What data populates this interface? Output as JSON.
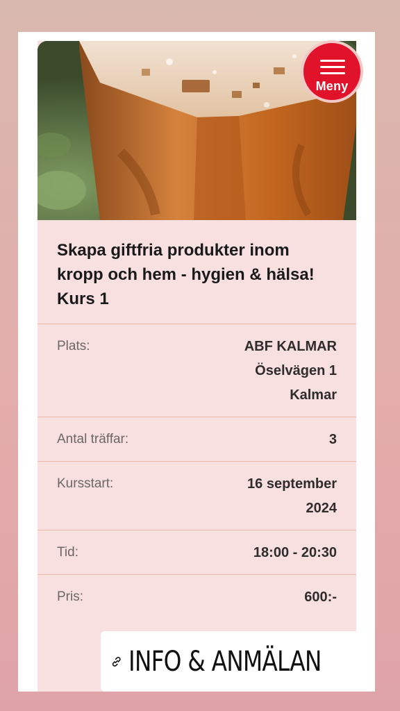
{
  "menu": {
    "label": "Meny"
  },
  "course": {
    "title": "Skapa giftfria produkter inom kropp och hem - hygien & hälsa! Kurs 1",
    "details": [
      {
        "label": "Plats:",
        "lines": [
          "ABF KALMAR",
          "Öselvägen 1",
          "Kalmar"
        ]
      },
      {
        "label": "Antal träffar:",
        "lines": [
          "3"
        ]
      },
      {
        "label": "Kursstart:",
        "lines": [
          "16 september",
          "2024"
        ]
      },
      {
        "label": "Tid:",
        "lines": [
          "18:00 - 20:30"
        ]
      },
      {
        "label": "Pris:",
        "lines": [
          "600:-"
        ]
      }
    ]
  },
  "cta": {
    "label": "INFO & ANMÄLAN",
    "icon": "link-icon"
  },
  "colors": {
    "accent": "#e0132a",
    "card_background": "#f8dfe0",
    "divider": "#efb7a6"
  }
}
